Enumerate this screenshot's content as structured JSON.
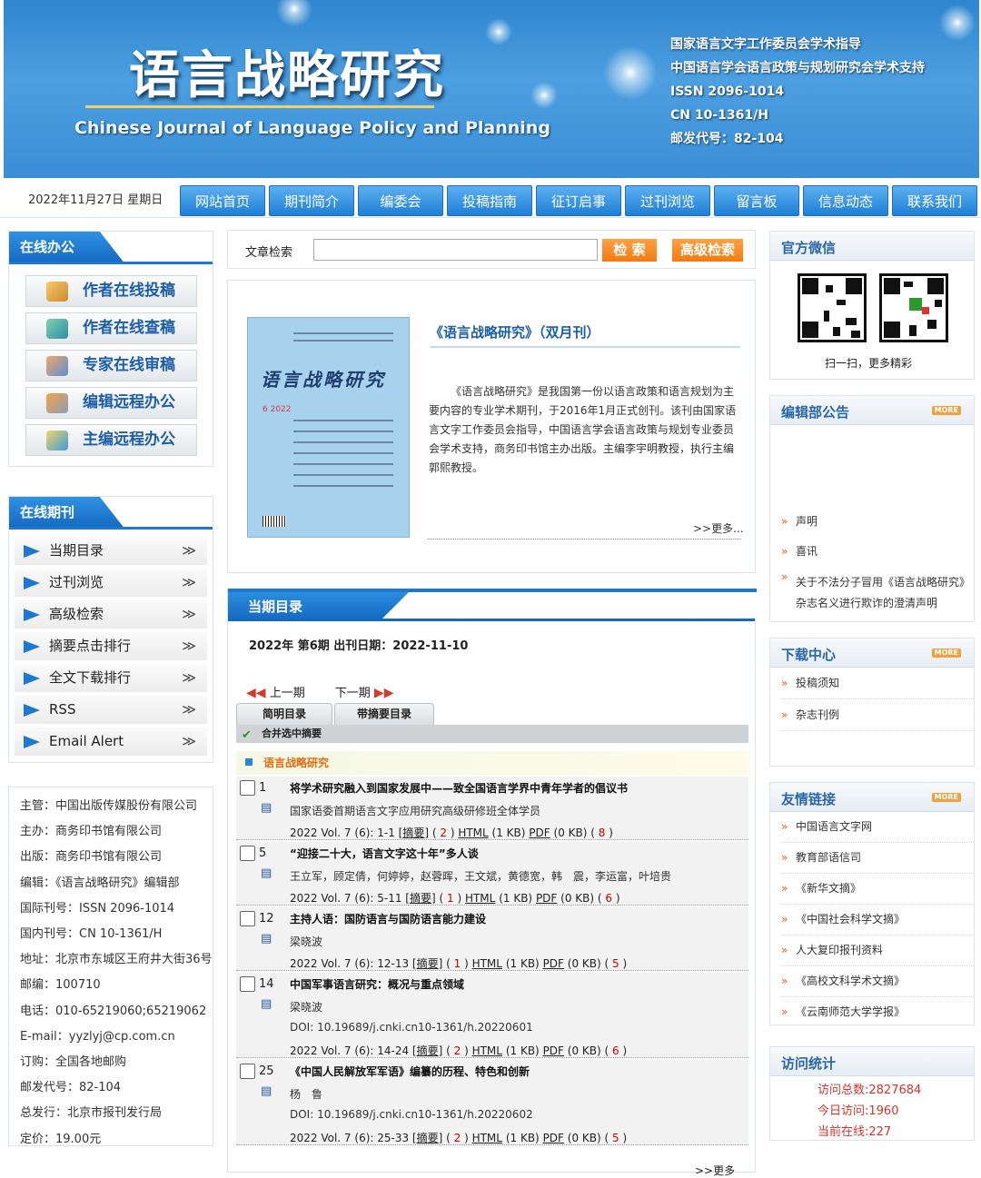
{
  "banner": {
    "title": "语言战略研究",
    "en_title": "Chinese Journal of Language Policy and Planning",
    "info": [
      "国家语言文字工作委员会学术指导",
      "中国语言学会语言政策与规划研究会学术支持",
      "ISSN  2096-1014",
      "CN  10-1361/H",
      "邮发代号：82-104"
    ]
  },
  "date": "2022年11月27日 星期日",
  "nav": [
    "网站首页",
    "期刊简介",
    "编委会",
    "投稿指南",
    "征订启事",
    "过刊浏览",
    "留言板",
    "信息动态",
    "联系我们"
  ],
  "office": {
    "title": "在线办公",
    "items": [
      "作者在线投稿",
      "作者在线查稿",
      "专家在线审稿",
      "编辑远程办公",
      "主编远程办公"
    ]
  },
  "issues": {
    "title": "在线期刊",
    "items": [
      "当期目录",
      "过刊浏览",
      "高级检索",
      "摘要点击排行",
      "全文下载排行",
      "RSS",
      "Email Alert"
    ],
    "arrow": "≫"
  },
  "pubinfo": [
    "主管：中国出版传媒股份有限公司",
    "主办：商务印书馆有限公司",
    "出版：商务印书馆有限公司",
    "编辑：《语言战略研究》编辑部",
    "国际刊号：ISSN 2096-1014",
    "国内刊号：CN 10-1361/H",
    "地址：北京市东城区王府井大街36号",
    "邮编：100710",
    "电话：010-65219060;65219062",
    "E-mail：yyzlyj@cp.com.cn",
    "订购：全国各地邮购",
    "邮发代号：82-104",
    "总发行：北京市报刊发行局",
    "定价：19.00元"
  ],
  "search": {
    "label": "文章检索",
    "btn": "检 索",
    "adv": "高级检索"
  },
  "intro": {
    "title": "《语言战略研究》（双月刊）",
    "desc": "《语言战略研究》是我国第一份以语言政策和语言规划为主要内容的专业学术期刊，于2016年1月正式创刊。该刊由国家语言文字工作委员会指导，中国语言学会语言政策与规划专业委员会学术支持，商务印书馆主办出版。主编李宇明教授，执行主编郭熙教授。",
    "more": ">>更多...",
    "cover_title": "语言战略研究",
    "cover_year": "6 2022"
  },
  "current": {
    "title": "当期目录",
    "meta": "2022年 第6期   出刊日期：2022-11-10",
    "prev": "上一期",
    "next": "下一期",
    "tab1": "简明目录",
    "tab2": "带摘要目录",
    "merge": "合并选中摘要",
    "section": "语言战略研究",
    "more": ">>更多"
  },
  "articles": [
    {
      "no": "1",
      "title": "将学术研究融入到国家发展中——致全国语言学界中青年学者的倡议书",
      "authors": "国家语委首期语言文字应用研究高级研修班全体学员",
      "doi": "",
      "cite": "2022 Vol. 7 (6): 1-1",
      "r1": "2",
      "r3": "8"
    },
    {
      "no": "5",
      "title": "“迎接二十大，语言文字这十年”多人谈",
      "authors": "王立军，顾定倩，何婷婷，赵蓉晖，王文斌，黄德宽，韩　震，李运富，叶培贵",
      "doi": "",
      "cite": "2022 Vol. 7 (6): 5-11",
      "r1": "1",
      "r3": "6"
    },
    {
      "no": "12",
      "title": "主持人语：国防语言与国防语言能力建设",
      "authors": "梁晓波",
      "doi": "",
      "cite": "2022 Vol. 7 (6): 12-13",
      "r1": "1",
      "r3": "5"
    },
    {
      "no": "14",
      "title": "中国军事语言研究：概况与重点领域",
      "authors": "梁晓波",
      "doi": "DOI: 10.19689/j.cnki.cn10-1361/h.20220601",
      "cite": "2022 Vol. 7 (6): 14-24",
      "r1": "2",
      "r3": "6"
    },
    {
      "no": "25",
      "title": "《中国人民解放军军语》编纂的历程、特色和创新",
      "authors": "杨　鲁",
      "doi": "DOI: 10.19689/j.cnki.cn10-1361/h.20220602",
      "cite": "2022 Vol. 7 (6): 25-33",
      "r1": "2",
      "r3": "5"
    }
  ],
  "links": {
    "abs": "摘要",
    "html": "HTML",
    "pdf": "PDF",
    "kb1": "(1 KB)",
    "kb0": "(0 KB)"
  },
  "weixin": {
    "title": "官方微信",
    "caption": "扫一扫，更多精彩"
  },
  "notice": {
    "title": "编辑部公告",
    "more": "MORE",
    "items": [
      "声明",
      "喜讯",
      "关于不法分子冒用《语言战略研究》杂志名义进行欺诈的澄清声明"
    ]
  },
  "download": {
    "title": "下载中心",
    "more": "MORE",
    "items": [
      "投稿须知",
      "杂志刊例"
    ]
  },
  "friends": {
    "title": "友情链接",
    "more": "MORE",
    "items": [
      "中国语言文字网",
      "教育部语信司",
      "《新华文摘》",
      "《中国社会科学文摘》",
      "人大复印报刊资料",
      "《高校文科学术文摘》",
      "《云南师范大学学报》"
    ]
  },
  "stats": {
    "title": "访问统计",
    "total": "访问总数:2827684",
    "today": "今日访问:1960",
    "online": "当前在线:227"
  }
}
